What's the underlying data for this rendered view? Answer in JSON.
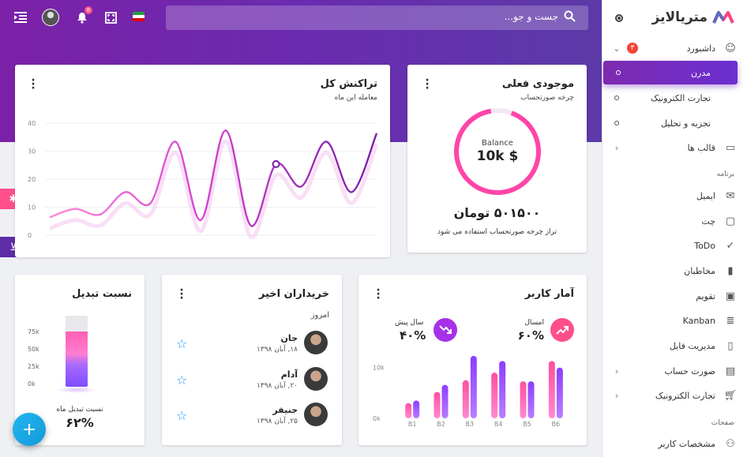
{
  "topbar": {
    "search_placeholder": "جست و جو...",
    "notification_count": "8"
  },
  "sidebar": {
    "logo_text": "متریالایز",
    "dashboard": {
      "label": "داشبورد",
      "badge": "۳"
    },
    "dashboard_items": [
      "مدرن",
      "تجارت الکترونیک",
      "تجزیه و تحلیل"
    ],
    "templates_label": "قالب ها",
    "section_app": "برنامه",
    "app_items": [
      "ایمیل",
      "چت",
      "ToDo",
      "مخاطبان",
      "تقویم",
      "Kanban",
      "مدیریت فایل",
      "صورت حساب",
      "تجارت الکترونیک"
    ],
    "section_pages": "صفحات",
    "pages_items": [
      "مشخصات کاربر"
    ]
  },
  "transactions": {
    "title": "تراکنش کل",
    "subtitle": "معامله این ماه",
    "y_ticks": [
      "40",
      "30",
      "20",
      "10",
      "0"
    ]
  },
  "balance": {
    "title": "موجودی فعلی",
    "subtitle": "چرخه صورتحساب",
    "ring_label": "Balance",
    "ring_value": "10k $",
    "amount": "۵۰۱۵۰۰ تومان",
    "caption": "تراز چرخه صورتحساب استفاده می شود"
  },
  "conversion": {
    "title": "نسبت تبدیل",
    "y_ticks": [
      "75k",
      "50k",
      "25k",
      "0k"
    ],
    "caption": "نسبت تبدیل ماه",
    "percent": "۶۲%",
    "percent_value": 62
  },
  "buyers": {
    "title": "خریداران اخیر",
    "today": "امروز",
    "list": [
      {
        "name": "جان",
        "date": "۱۸, آبان ۱۳۹۸"
      },
      {
        "name": "آدام",
        "date": "۲۰, آبان ۱۳۹۸"
      },
      {
        "name": "جنیفر",
        "date": "۲۵, آبان ۱۳۹۸"
      }
    ]
  },
  "user_stats": {
    "title": "آمار کاربر",
    "this_year_label": "امسال",
    "this_year_value": "۶۰%",
    "last_year_label": "سال پیش",
    "last_year_value": "۴۰%",
    "y_ticks": [
      "10k",
      "0k"
    ]
  },
  "chart_data": [
    {
      "type": "line",
      "title": "تراکنش کل",
      "ylim": [
        0,
        40
      ],
      "x": [
        0,
        1,
        2,
        3,
        4,
        5,
        6,
        7,
        8,
        9,
        10,
        11,
        12,
        13
      ],
      "series": [
        {
          "values": [
            3,
            6,
            4,
            12,
            8,
            30,
            2,
            34,
            0,
            22,
            14,
            30,
            12,
            33
          ]
        }
      ]
    },
    {
      "type": "bar",
      "title": "آمار کاربر",
      "categories": [
        "B1",
        "B2",
        "B3",
        "B4",
        "B5",
        "B6"
      ],
      "ylim": [
        0,
        14
      ],
      "series": [
        {
          "name": "امسال",
          "values": [
            3,
            5.2,
            7.5,
            9,
            7.3,
            11.3
          ]
        },
        {
          "name": "سال پیش",
          "values": [
            3.5,
            6.6,
            12.3,
            11.3,
            7.3,
            10
          ]
        }
      ]
    }
  ],
  "colors": {
    "primary": "#7b21a7",
    "accent_pink": "#ff4fa0",
    "accent_purple": "#8b3dff",
    "fab": "#1ea7e4"
  }
}
